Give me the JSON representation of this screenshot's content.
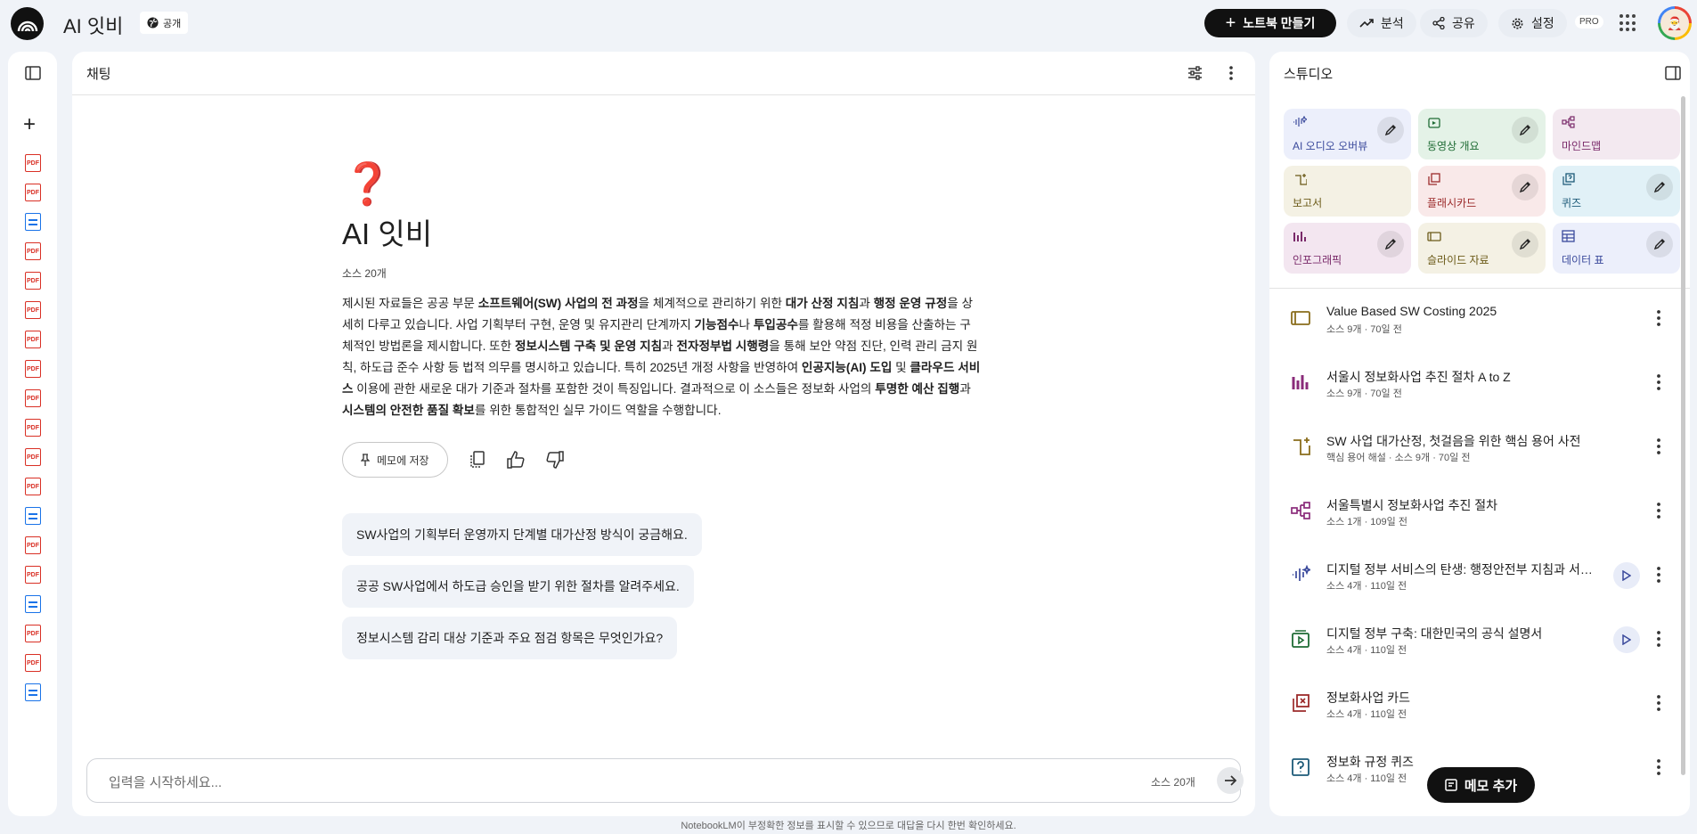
{
  "header": {
    "title": "AI 잇비",
    "visibility": "공개",
    "new_notebook": "노트북 만들기",
    "analytics": "분석",
    "share": "공유",
    "settings": "설정",
    "pro": "PRO"
  },
  "chat": {
    "panel_title": "채팅",
    "emoji": "❓",
    "notebook_title": "AI 잇비",
    "source_count": "소스 20개",
    "save_memo": "메모에 저장",
    "suggestions": [
      "SW사업의 기획부터 운영까지 단계별 대가산정 방식이 궁금해요.",
      "공공 SW사업에서 하도급 승인을 받기 위한 절차를 알려주세요.",
      "정보시스템 감리 대상 기준과 주요 점검 항목은 무엇인가요?"
    ],
    "input_placeholder": "입력을 시작하세요...",
    "input_source_count": "소스 20개"
  },
  "sources_icons": [
    "pdf",
    "pdf",
    "doc",
    "pdf",
    "pdf",
    "pdf",
    "pdf",
    "pdf",
    "pdf",
    "pdf",
    "pdf",
    "pdf",
    "doc",
    "pdf",
    "pdf",
    "doc",
    "pdf",
    "pdf",
    "doc"
  ],
  "studio": {
    "panel_title": "스튜디오",
    "tiles": [
      {
        "label": "AI 오디오 오버뷰",
        "bg": "#eceffb",
        "fg": "#3b4a9c",
        "edit": true
      },
      {
        "label": "동영상 개요",
        "bg": "#e4f2e7",
        "fg": "#1e6b34",
        "edit": true
      },
      {
        "label": "마인드맵",
        "bg": "#f3e9f0",
        "fg": "#7a2a6a",
        "edit": false
      },
      {
        "label": "보고서",
        "bg": "#f4f1e4",
        "fg": "#6b5a18",
        "edit": false
      },
      {
        "label": "플래시카드",
        "bg": "#f9e9e9",
        "fg": "#9c2b2b",
        "edit": true
      },
      {
        "label": "퀴즈",
        "bg": "#e1f1f7",
        "fg": "#1c5a78",
        "edit": true
      },
      {
        "label": "인포그래픽",
        "bg": "#f3e6f0",
        "fg": "#7a2a6a",
        "edit": true
      },
      {
        "label": "슬라이드 자료",
        "bg": "#f4f1e4",
        "fg": "#6b5a18",
        "edit": true
      },
      {
        "label": "데이터 표",
        "bg": "#eceffb",
        "fg": "#3b4a9c",
        "edit": true
      }
    ],
    "items": [
      {
        "title": "Value Based SW Costing 2025",
        "meta": "소스 9개 · 70일 전",
        "icon": "slides-icon",
        "color": "#8a6d1c",
        "play": false
      },
      {
        "title": "서울시 정보화사업 추진 절차 A to Z",
        "meta": "소스 9개 · 70일 전",
        "icon": "infographic-icon",
        "color": "#8a2b7a",
        "play": false
      },
      {
        "title": "SW 사업 대가산정, 첫걸음을 위한 핵심 용어 사전",
        "meta": "핵심 용어 해설 · 소스 9개 · 70일 전",
        "icon": "report-icon",
        "color": "#8a6d1c",
        "play": false
      },
      {
        "title": "서울특별시 정보화사업 추진 절차",
        "meta": "소스 1개 · 109일 전",
        "icon": "mindmap-icon",
        "color": "#8a2b7a",
        "play": false
      },
      {
        "title": "디지털 정부 서비스의 탄생: 행정안전부 지침과 서울특별시",
        "meta": "소스 4개 · 110일 전",
        "icon": "audio-icon",
        "color": "#3b4a9c",
        "play": true
      },
      {
        "title": "디지털 정부 구축: 대한민국의 공식 설명서",
        "meta": "소스 4개 · 110일 전",
        "icon": "video-icon",
        "color": "#1e6b34",
        "play": true
      },
      {
        "title": "정보화사업 카드",
        "meta": "소스 4개 · 110일 전",
        "icon": "flashcard-icon",
        "color": "#9c2b2b",
        "play": false
      },
      {
        "title": "정보화 규정 퀴즈",
        "meta": "소스 4개 · 110일 전",
        "icon": "quiz-icon",
        "color": "#1c5a78",
        "play": false
      }
    ],
    "add_memo": "메모 추가"
  },
  "footer": "NotebookLM이 부정확한 정보를 표시할 수 있으므로 대답을 다시 한번 확인하세요."
}
